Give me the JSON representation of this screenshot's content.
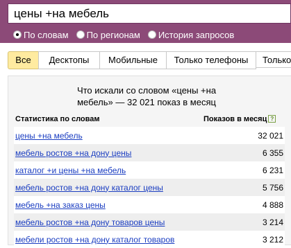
{
  "search": {
    "query": "цены +на мебель"
  },
  "radio_options": [
    {
      "label": "По словам",
      "checked": true
    },
    {
      "label": "По регионам",
      "checked": false
    },
    {
      "label": "История запросов",
      "checked": false
    }
  ],
  "tabs": [
    {
      "label": "Все",
      "active": true
    },
    {
      "label": "Десктопы",
      "active": false
    },
    {
      "label": "Мобильные",
      "active": false
    },
    {
      "label": "Только телефоны",
      "active": false
    },
    {
      "label": "Только",
      "active": false
    }
  ],
  "results": {
    "title_line1": "Что искали со словом «цены +на",
    "title_line2": "мебель» — 32 021 показ в месяц",
    "col_phrase": "Статистика по словам",
    "col_count": "Показов в месяц",
    "help": "?",
    "rows": [
      {
        "phrase": "цены +на мебель",
        "count": "32 021"
      },
      {
        "phrase": "мебель ростов +на дону цены",
        "count": "6 355"
      },
      {
        "phrase": "каталог +и цены +на мебель",
        "count": "6 231"
      },
      {
        "phrase": "мебель ростов +на дону каталог цены",
        "count": "5 756"
      },
      {
        "phrase": "мебель +на заказ цены",
        "count": "4 888"
      },
      {
        "phrase": "мебель ростов +на дону товаров цены",
        "count": "3 214"
      },
      {
        "phrase": "мебели ростов +на дону каталог товаров",
        "count": "3 212"
      }
    ]
  },
  "colors": {
    "header_bg": "#8c4a78",
    "link": "#1a3dc1",
    "active_tab": "#ffeba0"
  }
}
